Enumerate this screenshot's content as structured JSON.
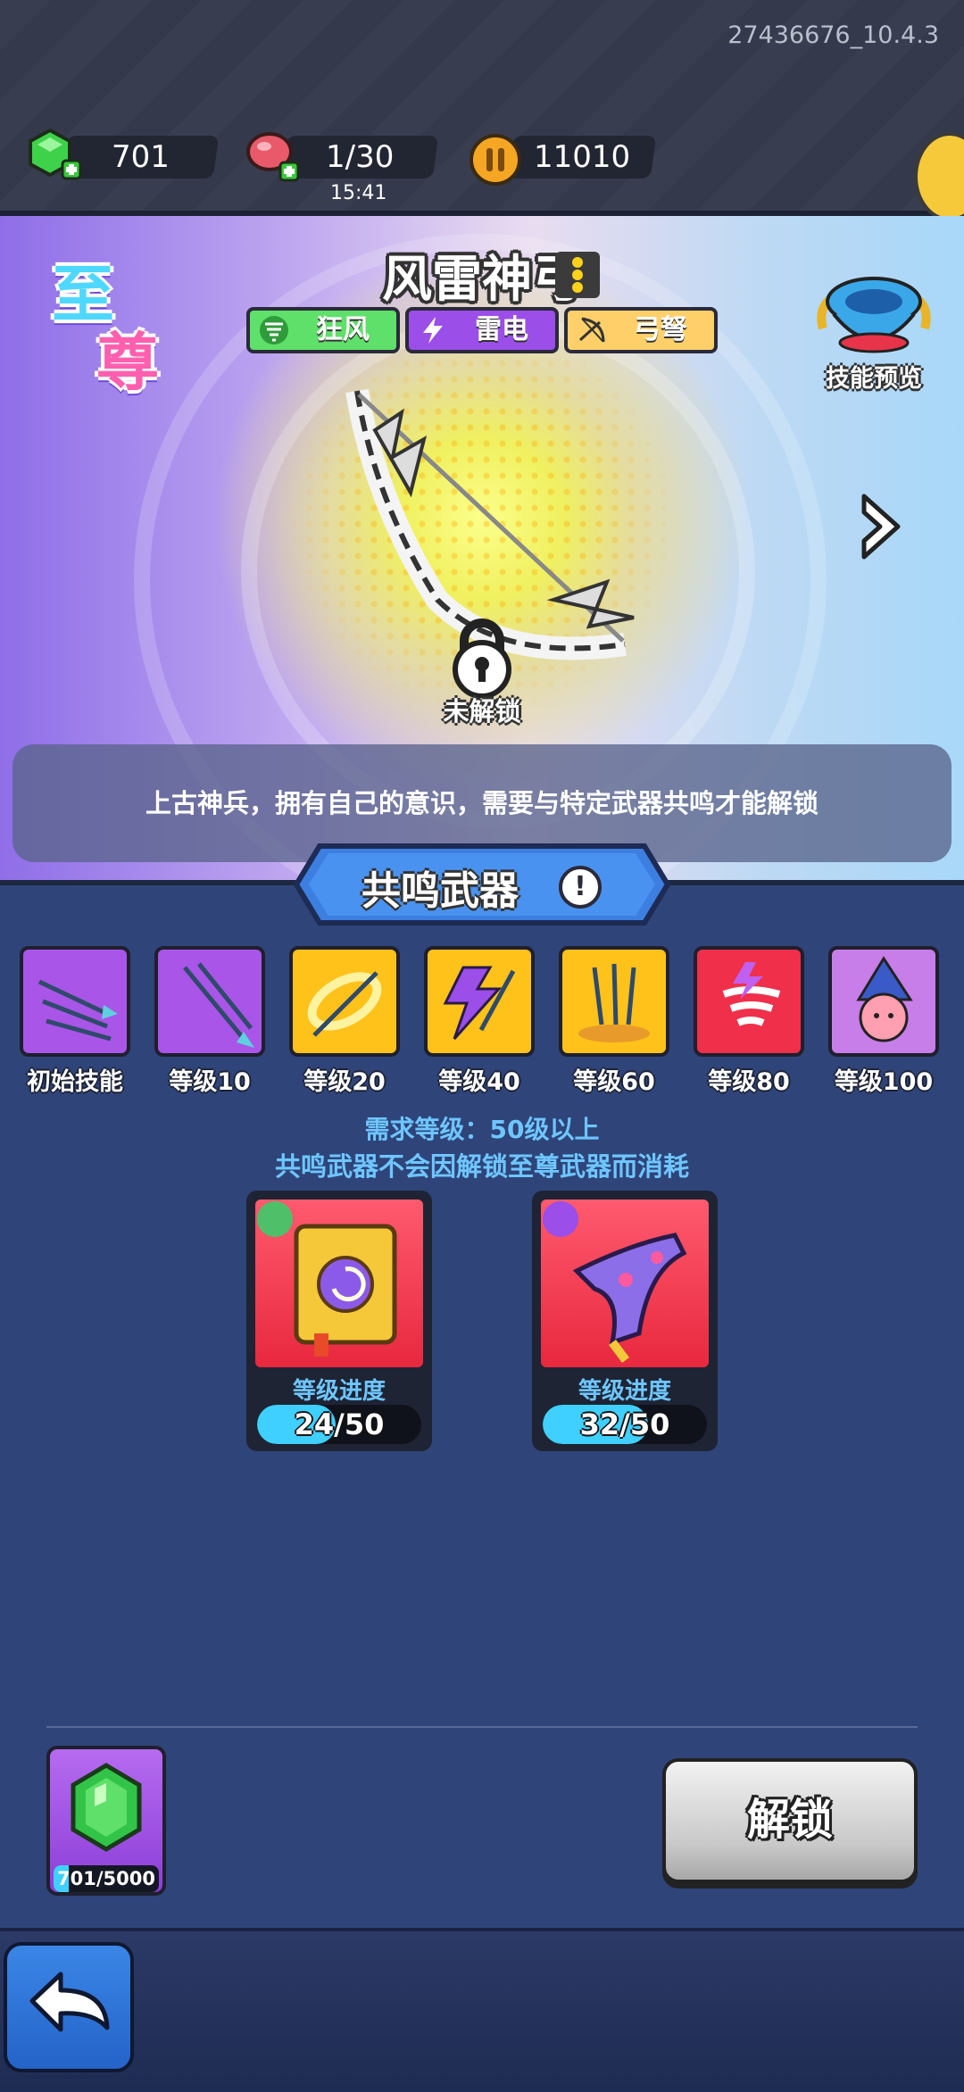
{
  "build_id": "27436676_10.4.3",
  "currency": {
    "gems": "701",
    "meat": "1/30",
    "meat_timer": "15:41",
    "coins": "11010"
  },
  "weapon": {
    "rarity_chars": [
      "至",
      "尊"
    ],
    "name": "风雷神弓",
    "tags": [
      {
        "label": "狂风",
        "color": "#5fe06a"
      },
      {
        "label": "雷电",
        "color": "#9b4ee8"
      },
      {
        "label": "弓弩",
        "color": "#ffcf6a"
      }
    ],
    "skill_preview_label": "技能预览",
    "lock_label": "未解锁",
    "description": "上古神兵，拥有自己的意识，需要与特定武器共鸣才能解锁"
  },
  "section": {
    "title": "共鸣武器"
  },
  "skills": [
    {
      "label": "初始技能",
      "bg": "#a855e8",
      "icon": "triple-arrows-icon"
    },
    {
      "label": "等级10",
      "bg": "#a855e8",
      "icon": "double-arrow-icon"
    },
    {
      "label": "等级20",
      "bg": "#ffc21a",
      "icon": "golden-ring-icon"
    },
    {
      "label": "等级40",
      "bg": "#ffc21a",
      "icon": "lightning-arrows-icon"
    },
    {
      "label": "等级60",
      "bg": "#ffc21a",
      "icon": "arrow-rain-icon"
    },
    {
      "label": "等级80",
      "bg": "#f0304a",
      "icon": "tornado-icon"
    },
    {
      "label": "等级100",
      "bg": "#c77ee8",
      "icon": "wizard-character-icon"
    }
  ],
  "requirement": {
    "level": "需求等级：50级以上",
    "note": "共鸣武器不会因解锁至尊武器而消耗"
  },
  "resonance_weapons": [
    {
      "progress_label": "等级进度",
      "current": 24,
      "max": 50,
      "text": "24/50",
      "element": "wind",
      "icon": "spellbook-icon"
    },
    {
      "progress_label": "等级进度",
      "current": 32,
      "max": 50,
      "text": "32/50",
      "element": "lightning",
      "icon": "boomerang-icon"
    }
  ],
  "unlock_cost": {
    "current": 701,
    "required": 5000,
    "text": "701/5000"
  },
  "unlock_button": "解锁",
  "colors": {
    "panel_bg": "#2f4479",
    "accent_blue": "#6ec6ff",
    "progress_fill": "#3fd0ff"
  }
}
